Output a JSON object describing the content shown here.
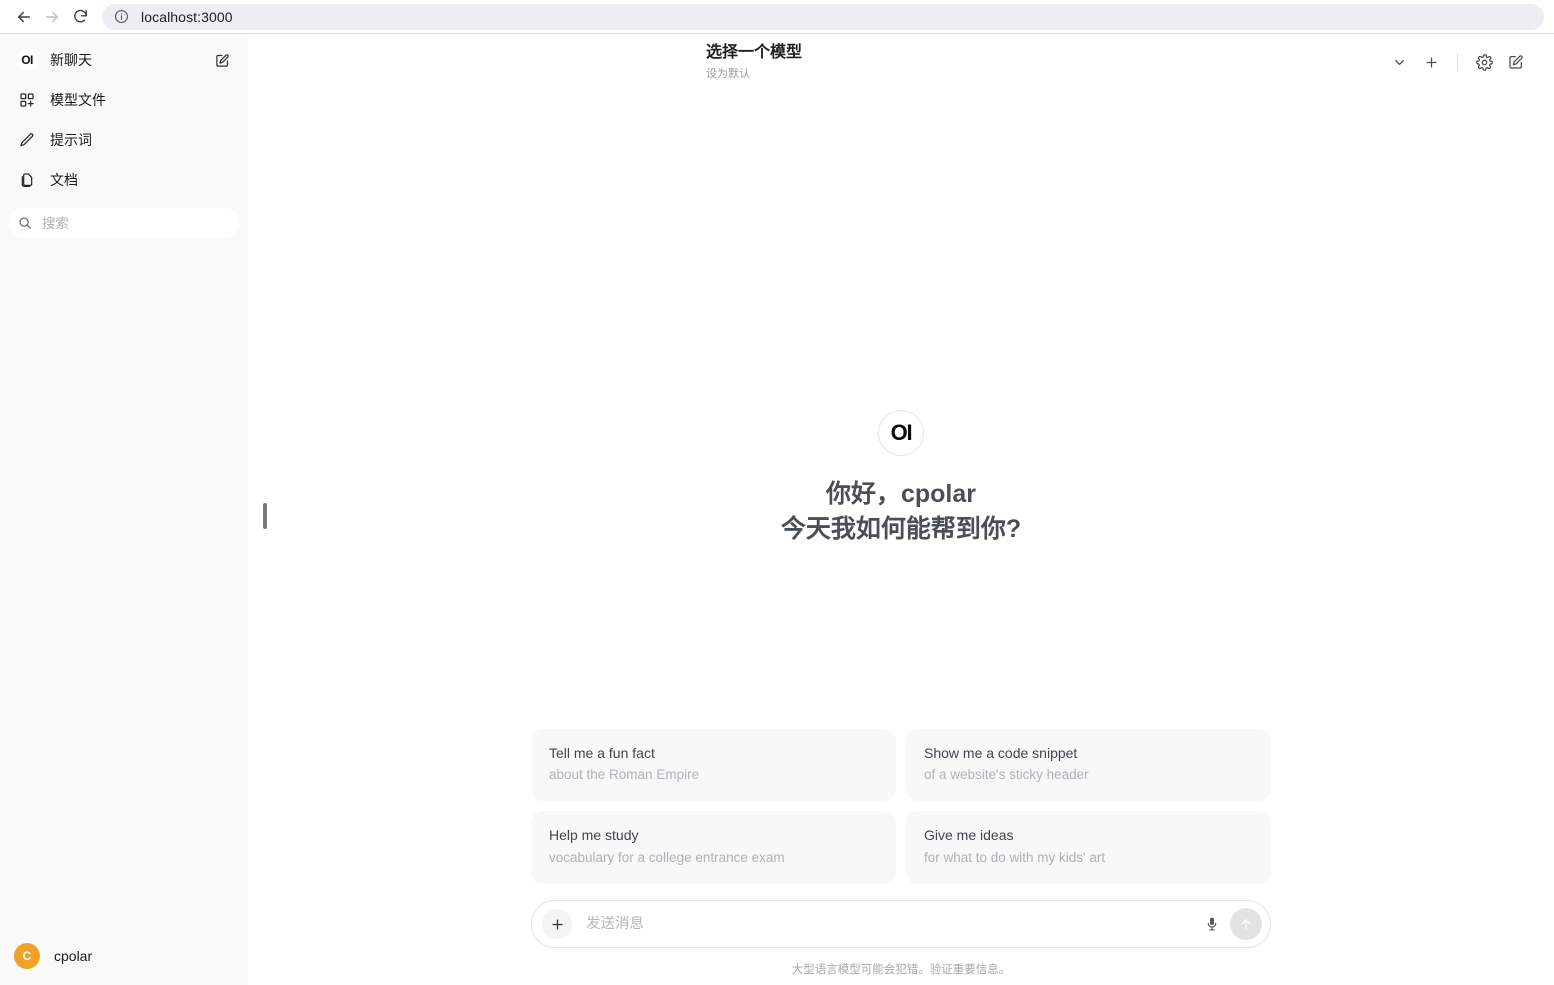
{
  "browser": {
    "back_icon": "arrow-left-icon",
    "forward_icon": "arrow-right-icon",
    "reload_icon": "reload-icon",
    "site_info_icon": "info-circle-icon",
    "url": "localhost:3000"
  },
  "sidebar": {
    "logo_text": "OI",
    "items": [
      {
        "label": "新聊天",
        "icon": "openwebui-logo-icon",
        "trailing_icon": "new-chat-edit-icon"
      },
      {
        "label": "模型文件",
        "icon": "modelfiles-grid-icon"
      },
      {
        "label": "提示词",
        "icon": "pencil-icon"
      },
      {
        "label": "文档",
        "icon": "documents-icon"
      }
    ],
    "search": {
      "placeholder": "搜索",
      "value": "",
      "icon": "search-icon"
    },
    "user": {
      "name": "cpolar",
      "avatar_letter": "C",
      "avatar_color": "#f0a226"
    },
    "resize_handle": "sidebar-resize-handle",
    "background_color": "#f9f9f9"
  },
  "header": {
    "model_title": "选择一个模型",
    "model_subtitle": "设为默认",
    "chevron_icon": "chevron-down-icon",
    "plus_icon": "plus-icon",
    "settings_icon": "gear-icon",
    "new_chat_icon": "compose-edit-icon"
  },
  "greeting": {
    "logo_text": "OI",
    "line1": "你好，cpolar",
    "line2": "今天我如何能帮到你?"
  },
  "suggestions": [
    {
      "title": "Tell me a fun fact",
      "subtitle": "about the Roman Empire"
    },
    {
      "title": "Show me a code snippet",
      "subtitle": "of a website's sticky header"
    },
    {
      "title": "Help me study",
      "subtitle": "vocabulary for a college entrance exam"
    },
    {
      "title": "Give me ideas",
      "subtitle": "for what to do with my kids' art"
    }
  ],
  "composer": {
    "placeholder": "发送消息",
    "value": "",
    "plus_icon": "plus-icon",
    "mic_icon": "microphone-icon",
    "send_icon": "arrow-up-send-icon",
    "disclaimer": "大型语言模型可能会犯错。验证重要信息。"
  }
}
